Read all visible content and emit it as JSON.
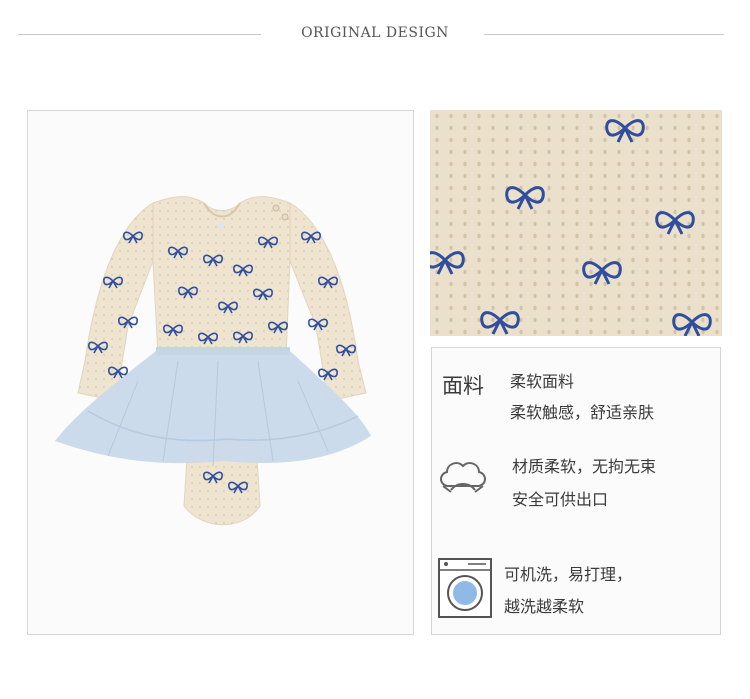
{
  "header": {
    "title": "ORIGINAL DESIGN"
  },
  "features": [
    {
      "icon": "fabric-label",
      "label": "面料",
      "lines": [
        "柔软面料",
        "柔软触感，舒适亲肤"
      ]
    },
    {
      "icon": "cotton-icon",
      "lines": [
        "材质柔软，无拘无束",
        "安全可供出口"
      ]
    },
    {
      "icon": "washing-machine-icon",
      "lines": [
        "可机洗，易打理，",
        "越洗越柔软"
      ]
    }
  ],
  "colors": {
    "fabric": "#efe4cf",
    "bow": "#2f4f9e",
    "tulle": "#c9d9ea",
    "line": "#c9c9c9"
  }
}
